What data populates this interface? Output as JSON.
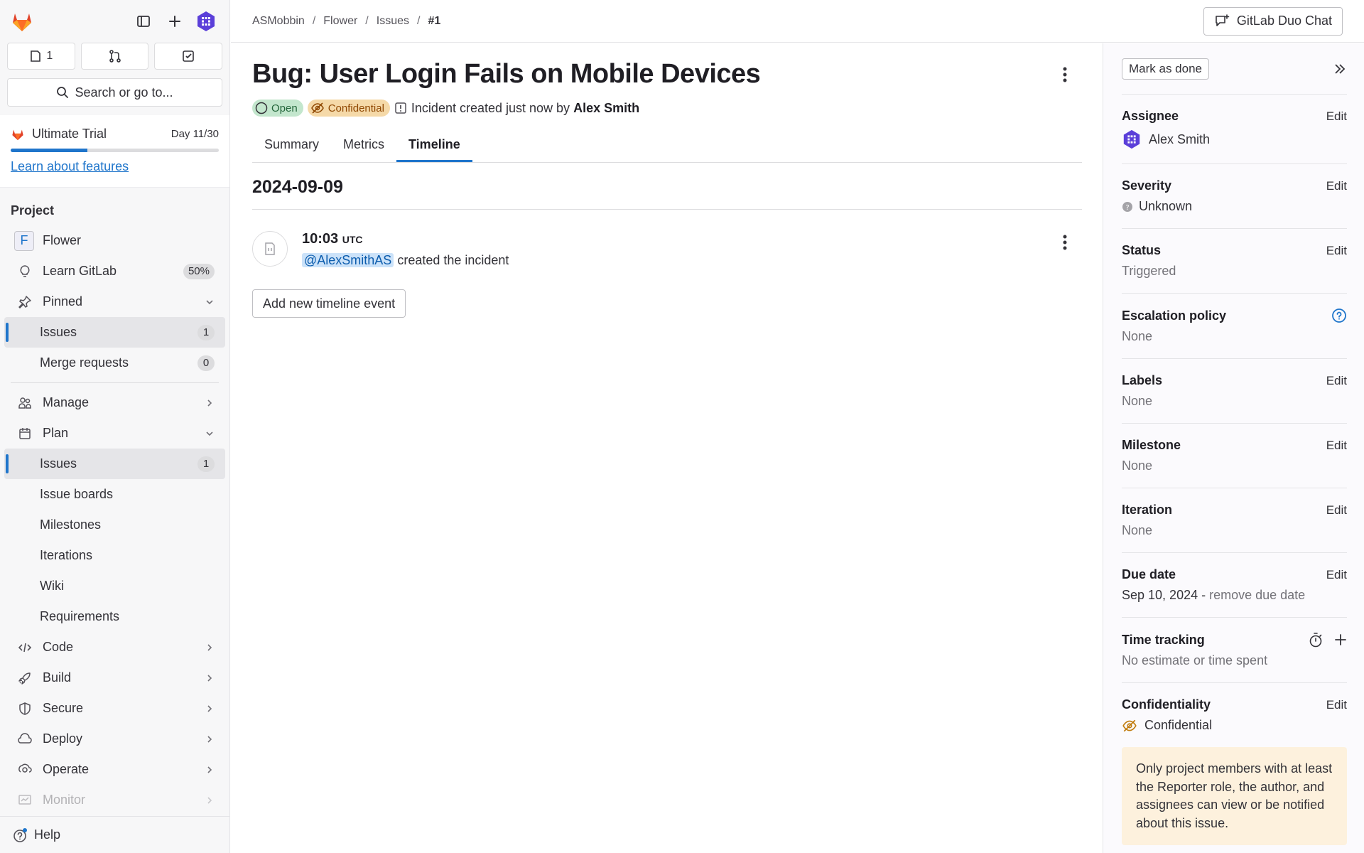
{
  "sidebar": {
    "issue_count": "1",
    "search_placeholder": "Search or go to...",
    "trial": {
      "title": "Ultimate Trial",
      "day": "Day 11/30",
      "progress_fraction": 0.37,
      "learn_link": "Learn about features"
    },
    "section_title": "Project",
    "project_name": "Flower",
    "project_letter": "F",
    "learn_gitlab": {
      "label": "Learn GitLab",
      "badge": "50%"
    },
    "pinned": {
      "label": "Pinned",
      "items": [
        {
          "label": "Issues",
          "badge": "1"
        },
        {
          "label": "Merge requests",
          "badge": "0"
        }
      ]
    },
    "manage_label": "Manage",
    "plan": {
      "label": "Plan",
      "items": [
        {
          "label": "Issues",
          "badge": "1"
        },
        {
          "label": "Issue boards"
        },
        {
          "label": "Milestones"
        },
        {
          "label": "Iterations"
        },
        {
          "label": "Wiki"
        },
        {
          "label": "Requirements"
        }
      ]
    },
    "groups": {
      "code": "Code",
      "build": "Build",
      "secure": "Secure",
      "deploy": "Deploy",
      "operate": "Operate",
      "monitor": "Monitor"
    },
    "help_label": "Help"
  },
  "topbar": {
    "breadcrumbs": [
      "ASMobbin",
      "Flower",
      "Issues",
      "#1"
    ],
    "duo_label": "GitLab Duo Chat"
  },
  "issue": {
    "title": "Bug: User Login Fails on Mobile Devices",
    "status": "Open",
    "confidential": "Confidential",
    "meta_prefix": "Incident created just now by",
    "author": "Alex Smith",
    "tabs": [
      "Summary",
      "Metrics",
      "Timeline"
    ],
    "active_tab": "Timeline",
    "timeline": {
      "date": "2024-09-09",
      "events": [
        {
          "time": "10:03",
          "tz": "UTC",
          "mention": "@AlexSmithAS",
          "text": "created the incident"
        }
      ],
      "add_label": "Add new timeline event"
    }
  },
  "rightbar": {
    "mark_done": "Mark as done",
    "edit": "Edit",
    "assignee": {
      "label": "Assignee",
      "value": "Alex Smith"
    },
    "severity": {
      "label": "Severity",
      "value": "Unknown"
    },
    "status": {
      "label": "Status",
      "value": "Triggered"
    },
    "escalation": {
      "label": "Escalation policy",
      "value": "None"
    },
    "labels": {
      "label": "Labels",
      "value": "None"
    },
    "milestone": {
      "label": "Milestone",
      "value": "None"
    },
    "iteration": {
      "label": "Iteration",
      "value": "None"
    },
    "due_date": {
      "label": "Due date",
      "value": "Sep 10, 2024",
      "separator": " - ",
      "remove": "remove due date"
    },
    "time_tracking": {
      "label": "Time tracking",
      "value": "No estimate or time spent"
    },
    "confidentiality": {
      "label": "Confidentiality",
      "value": "Confidential",
      "note": "Only project members with at least the Reporter role, the author, and assignees can view or be notified about this issue."
    }
  },
  "colors": {
    "accent": "#1f75cb",
    "brand_orange": "#e24329",
    "avatar_purple": "#5b3fd9"
  }
}
